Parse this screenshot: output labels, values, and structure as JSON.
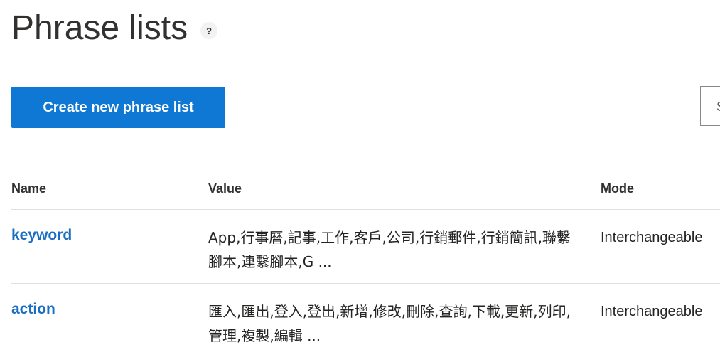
{
  "header": {
    "title": "Phrase lists",
    "help_label": "?"
  },
  "toolbar": {
    "create_label": "Create new phrase list",
    "search_placeholder": "S"
  },
  "table": {
    "columns": [
      "Name",
      "Value",
      "Mode"
    ],
    "rows": [
      {
        "name": "keyword",
        "value": "App,行事曆,記事,工作,客戶,公司,行銷郵件,行銷簡訊,聯繫腳本,連繫腳本,G ...",
        "mode": "Interchangeable"
      },
      {
        "name": "action",
        "value": "匯入,匯出,登入,登出,新增,修改,刪除,查詢,下載,更新,列印,管理,複製,編輯 ...",
        "mode": "Interchangeable"
      }
    ]
  }
}
